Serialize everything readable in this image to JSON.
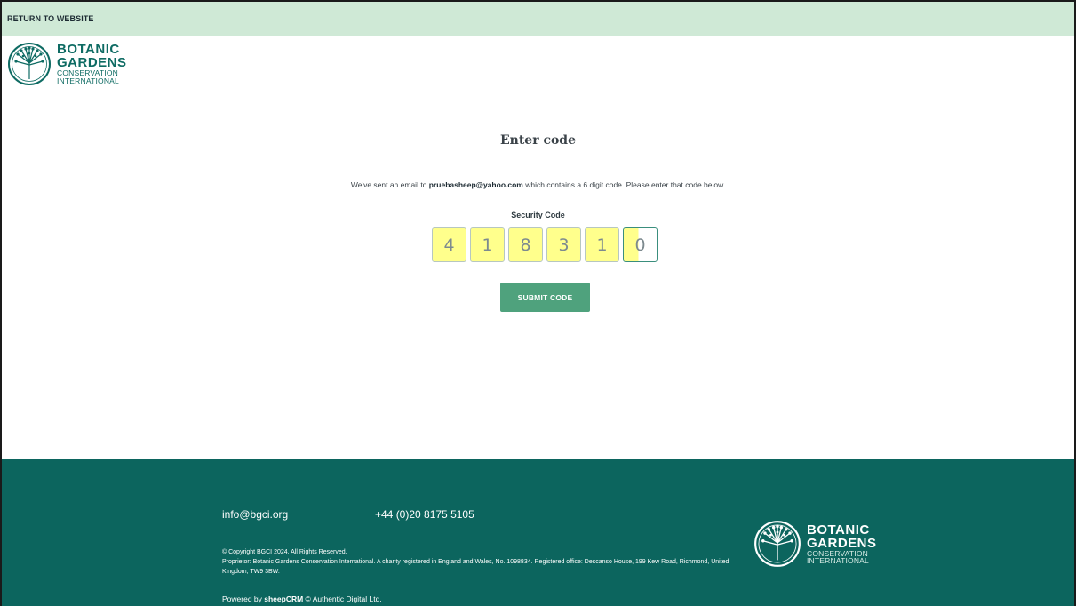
{
  "topbar": {
    "return_link": "RETURN TO WEBSITE"
  },
  "brand": {
    "line1": "BOTANIC",
    "line2": "GARDENS",
    "line3": "CONSERVATION",
    "line4": "INTERNATIONAL",
    "color": "#0e6b63"
  },
  "page": {
    "title": "Enter code",
    "message_prefix": "We've sent an email to ",
    "email": "pruebasheep@yahoo.com",
    "message_suffix": " which contains a 6 digit code. Please enter that code below.",
    "code_label": "Security Code",
    "digits": [
      "4",
      "1",
      "8",
      "3",
      "1",
      "0"
    ],
    "submit_label": "SUBMIT CODE",
    "accent": "#4fa27d"
  },
  "footer": {
    "email": "info@bgci.org",
    "phone": "+44 (0)20 8175 5105",
    "copyright": "© Copyright BGCI 2024. All Rights Reserved.",
    "proprietor": "Proprietor: Botanic Gardens Conservation International. A charity registered in England and Wales, No. 1098834. Registered office: Descanso House, 199 Kew Road, Richmond, United Kingdom, TW9 3BW.",
    "powered_prefix": "Powered by ",
    "powered_brand": "sheepCRM",
    "powered_suffix": " © Authentic Digital Ltd.",
    "background": "#0c655e"
  }
}
